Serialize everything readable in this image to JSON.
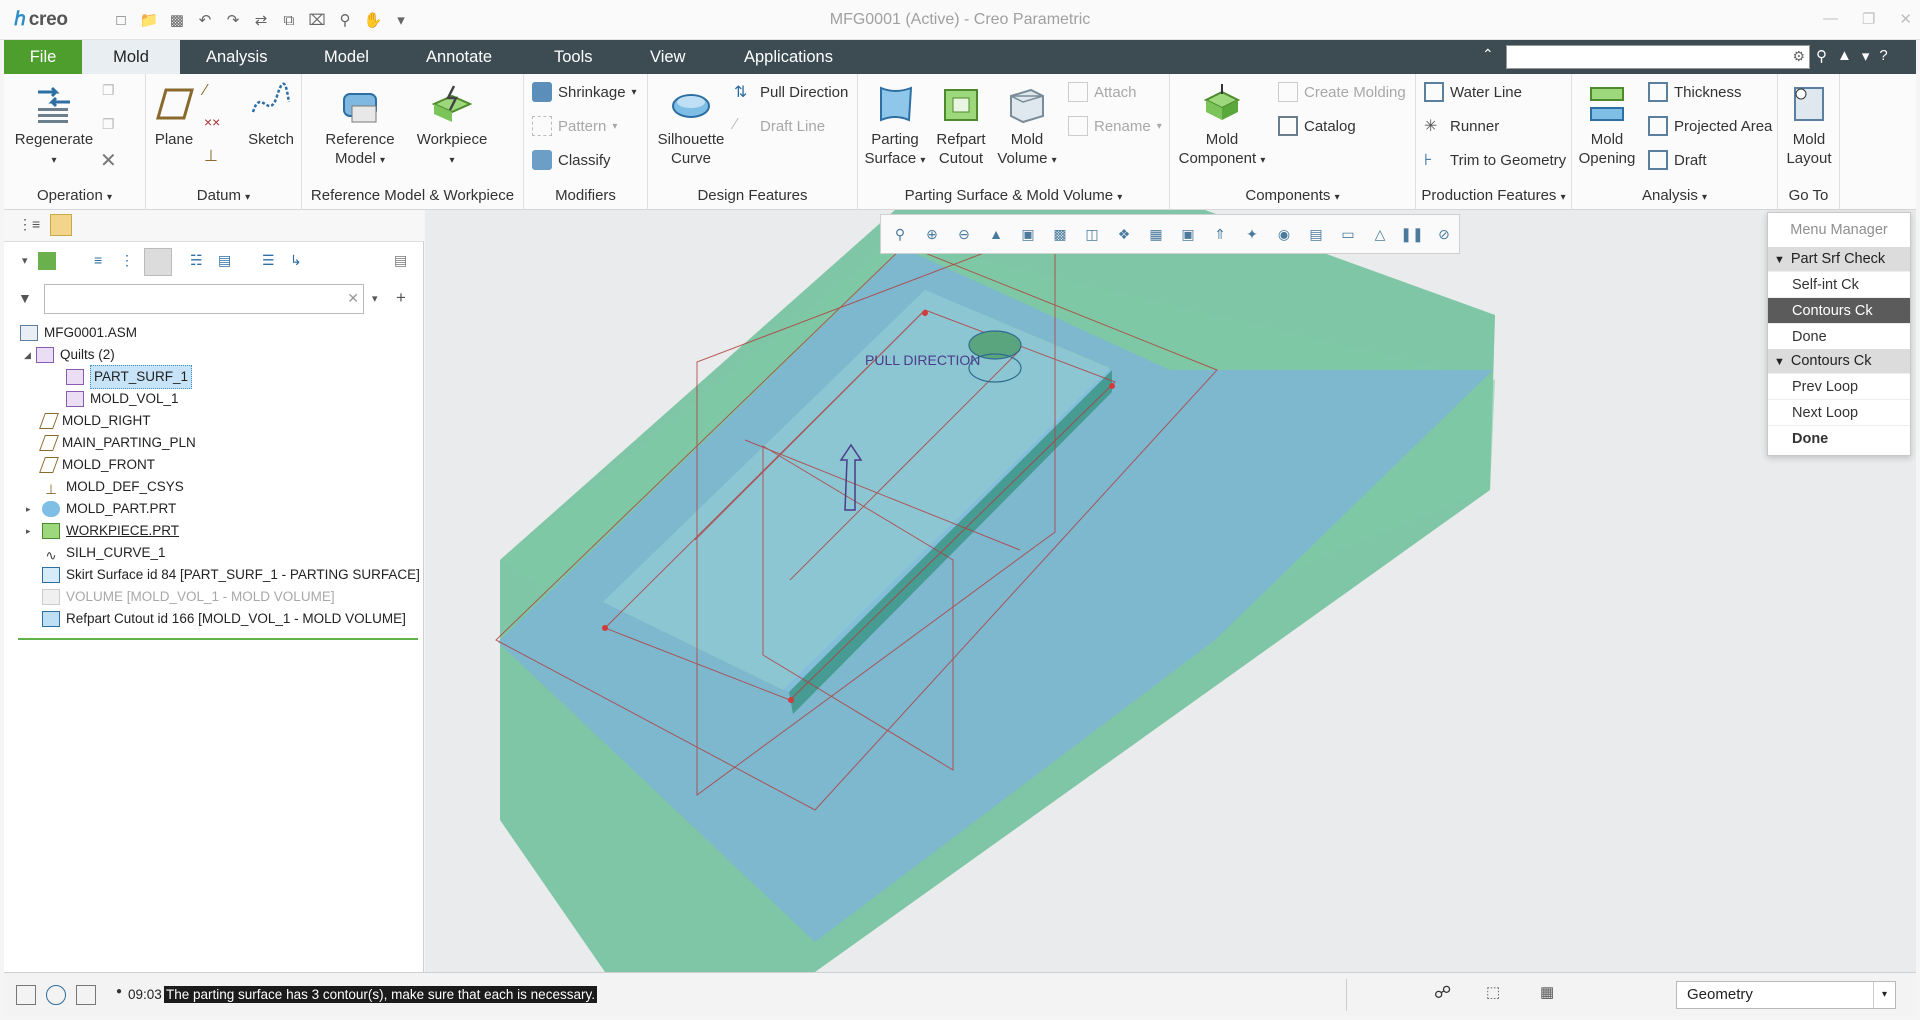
{
  "app": {
    "logo": "creo",
    "window_title": "MFG0001 (Active) - Creo Parametric"
  },
  "tabs": [
    "File",
    "Mold",
    "Analysis",
    "Model",
    "Annotate",
    "Tools",
    "View",
    "Applications"
  ],
  "active_tab": "Mold",
  "ribbon": {
    "operation": {
      "regenerate": "Regenerate",
      "group": "Operation"
    },
    "datum": {
      "plane": "Plane",
      "sketch": "Sketch",
      "group": "Datum"
    },
    "refmodel": {
      "reference_model_1": "Reference",
      "reference_model_2": "Model",
      "workpiece": "Workpiece",
      "group": "Reference Model & Workpiece"
    },
    "modifiers": {
      "shrinkage": "Shrinkage",
      "pattern": "Pattern",
      "classify": "Classify",
      "group": "Modifiers"
    },
    "design": {
      "silhouette_1": "Silhouette",
      "silhouette_2": "Curve",
      "pull_direction": "Pull Direction",
      "draft_line": "Draft Line",
      "group": "Design Features"
    },
    "parting": {
      "parting_1": "Parting",
      "parting_2": "Surface",
      "refpart_1": "Refpart",
      "refpart_2": "Cutout",
      "moldvol_1": "Mold",
      "moldvol_2": "Volume",
      "attach": "Attach",
      "rename": "Rename",
      "group": "Parting Surface & Mold Volume"
    },
    "components": {
      "mold_comp_1": "Mold",
      "mold_comp_2": "Component",
      "create_molding": "Create Molding",
      "catalog": "Catalog",
      "group": "Components"
    },
    "production": {
      "water_line": "Water Line",
      "runner": "Runner",
      "trim": "Trim to Geometry",
      "group": "Production Features"
    },
    "analysis": {
      "mold_opening_1": "Mold",
      "mold_opening_2": "Opening",
      "thickness": "Thickness",
      "projected_area": "Projected Area",
      "draft": "Draft",
      "group": "Analysis"
    },
    "goto": {
      "mold_layout_1": "Mold",
      "mold_layout_2": "Layout",
      "group": "Go To"
    }
  },
  "tree": [
    {
      "label": "MFG0001.ASM",
      "icon": "assembly-icon"
    },
    {
      "label": "Quilts (2)",
      "icon": "quilt-icon"
    },
    {
      "label": "PART_SURF_1",
      "icon": "surface-icon"
    },
    {
      "label": "MOLD_VOL_1",
      "icon": "surface-icon"
    },
    {
      "label": "MOLD_RIGHT",
      "icon": "datum-plane-icon"
    },
    {
      "label": "MAIN_PARTING_PLN",
      "icon": "datum-plane-icon"
    },
    {
      "label": "MOLD_FRONT",
      "icon": "datum-plane-icon"
    },
    {
      "label": "MOLD_DEF_CSYS",
      "icon": "csys-icon"
    },
    {
      "label": "MOLD_PART.PRT",
      "icon": "part-icon"
    },
    {
      "label": "WORKPIECE.PRT",
      "icon": "workpiece-icon"
    },
    {
      "label": "SILH_CURVE_1",
      "icon": "curve-icon"
    },
    {
      "label": "Skirt Surface id 84 [PART_SURF_1 - PARTING SURFACE]",
      "icon": "skirt-surface-icon"
    },
    {
      "label": "VOLUME [MOLD_VOL_1 - MOLD VOLUME]",
      "icon": "volume-icon"
    },
    {
      "label": "Refpart Cutout id 166 [MOLD_VOL_1 - MOLD VOLUME]",
      "icon": "refpart-cutout-icon"
    }
  ],
  "viewport": {
    "pull_direction_label": "PULL DIRECTION"
  },
  "menu_manager": {
    "title": "Menu Manager",
    "section1": "Part Srf Check",
    "self_int": "Self-int Ck",
    "contours": "Contours Ck",
    "done1": "Done",
    "section2": "Contours Ck",
    "prev_loop": "Prev Loop",
    "next_loop": "Next Loop",
    "done2": "Done"
  },
  "status": {
    "time": "09:03",
    "message": "The parting surface has 3 contour(s), make sure that each is necessary.",
    "filter": "Geometry"
  },
  "colors": {
    "file_tab": "#4d9e2c",
    "tabbar": "#3d4b52",
    "mold_green": "#5fba8a",
    "part_blue": "#6fa8dc"
  }
}
